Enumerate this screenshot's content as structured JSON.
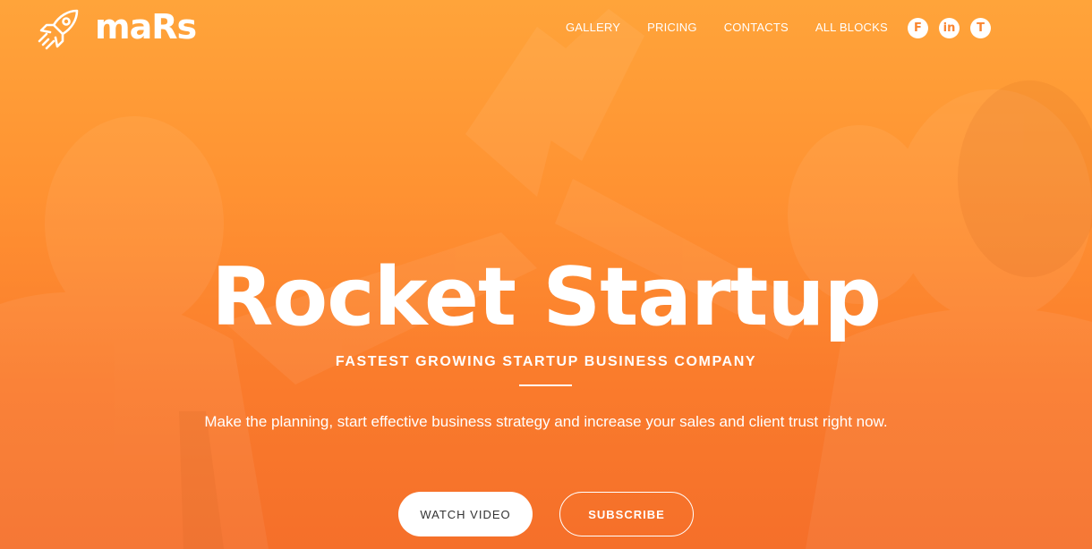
{
  "brand": {
    "name": "maRs",
    "logo_icon": "rocket-icon"
  },
  "nav": {
    "items": [
      {
        "label": "GALLERY"
      },
      {
        "label": "PRICING"
      },
      {
        "label": "CONTACTS"
      },
      {
        "label": "ALL BLOCKS"
      }
    ]
  },
  "social": {
    "items": [
      {
        "label": "F",
        "icon": "facebook-icon"
      },
      {
        "label": "in",
        "icon": "linkedin-icon"
      },
      {
        "label": "T",
        "icon": "twitter-icon"
      }
    ]
  },
  "hero": {
    "title": "Rocket Startup",
    "subtitle": "FASTEST GROWING STARTUP BUSINESS COMPANY",
    "lead": "Make the planning, start effective business strategy and increase your sales and client trust right now.",
    "watch_label": "WATCH VIDEO",
    "subscribe_label": "SUBSCRIBE"
  },
  "colors": {
    "accent": "#ff9232",
    "overlay_top": "#ffa43a",
    "overlay_bottom": "#f56f2a"
  }
}
